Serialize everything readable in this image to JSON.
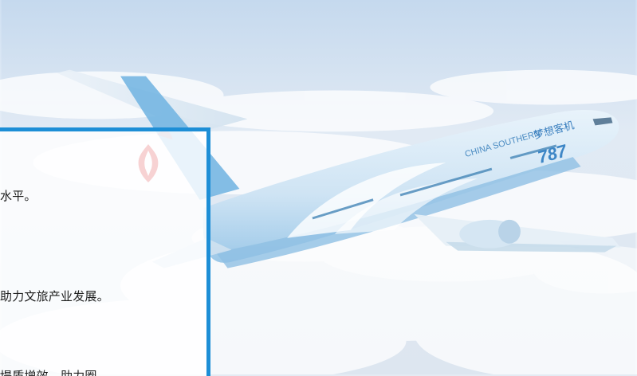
{
  "panel": {
    "lines": [
      "水平。",
      "助力文旅产业发展。",
      "堤质增效，助力圈"
    ]
  },
  "aircraft": {
    "livery_text": "CHINA SOUTHERN",
    "model_text": "787",
    "nose_text": "梦想客机"
  },
  "colors": {
    "panel_border": "#1d8ed6",
    "bullet": "#ffcc33",
    "fuselage": "#d7e9f6",
    "tail": "#5da9dc"
  },
  "icons": [
    "airline-logo-icon"
  ]
}
